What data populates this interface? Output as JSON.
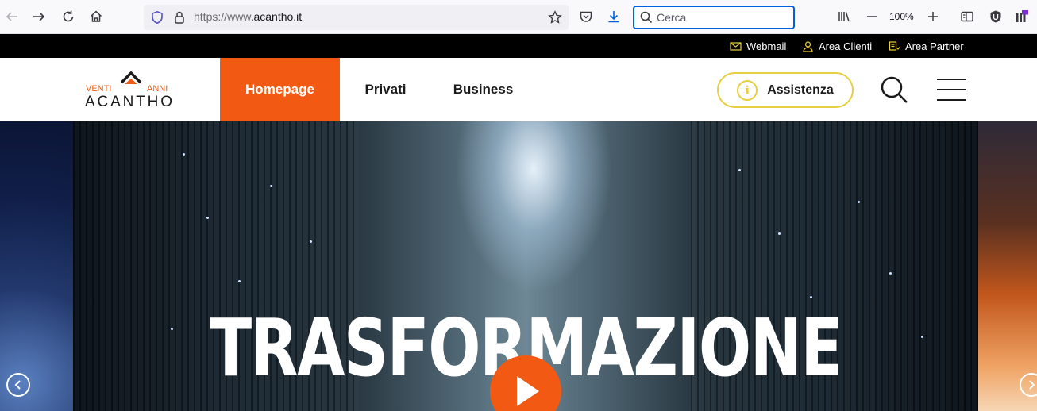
{
  "browser": {
    "url_scheme": "https://www.",
    "url_domain": "acantho.it",
    "search_placeholder": "Cerca",
    "zoom": "100%"
  },
  "utility_bar": {
    "links": [
      {
        "label": "Webmail",
        "icon": "mail-icon"
      },
      {
        "label": "Area Clienti",
        "icon": "user-icon"
      },
      {
        "label": "Area Partner",
        "icon": "partner-icon"
      }
    ]
  },
  "header": {
    "logo": {
      "top_left": "VENTI",
      "top_right": "ANNI",
      "main": "ACANTHO"
    },
    "nav": [
      {
        "label": "Homepage",
        "active": true
      },
      {
        "label": "Privati",
        "active": false
      },
      {
        "label": "Business",
        "active": false
      }
    ],
    "assist_label": "Assistenza"
  },
  "hero": {
    "title": "TRASFORMAZIONE"
  },
  "colors": {
    "accent": "#f25a13",
    "assist_border": "#e8cf42",
    "utility_bg": "#000000"
  }
}
